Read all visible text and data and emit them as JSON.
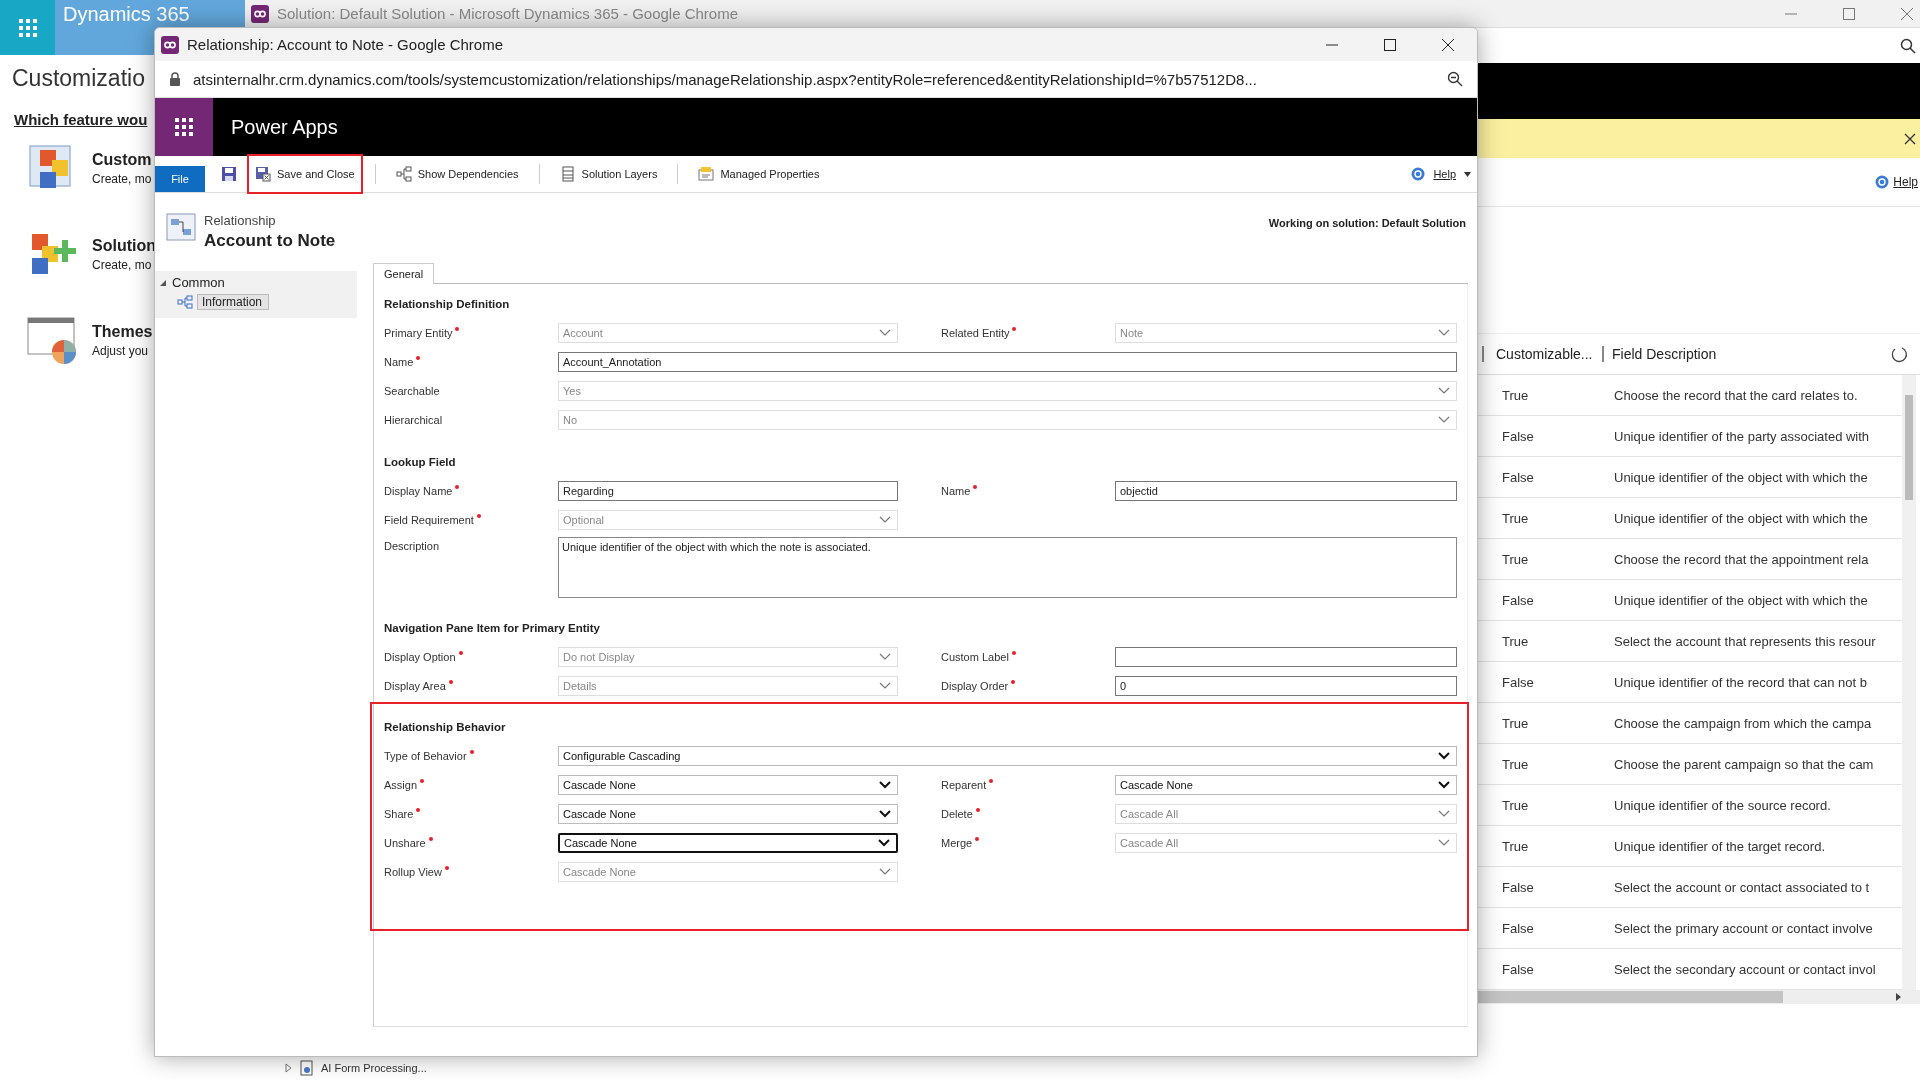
{
  "background": {
    "title": "Solution: Default Solution - Microsoft Dynamics 365 - Google Chrome",
    "app_name": "Dynamics 365",
    "page_title": "Customizatio",
    "question": "Which feature wou",
    "features": [
      {
        "title": "Custom",
        "description": "Create, mo"
      },
      {
        "title": "Solution",
        "description": "Create, mo"
      },
      {
        "title": "Themes",
        "description": "Adjust you"
      }
    ],
    "help": "Help",
    "table": {
      "columns": [
        "Customizable...",
        "Field Description"
      ],
      "rows": [
        {
          "customizable": "True",
          "description": "Choose the record that the card relates to."
        },
        {
          "customizable": "False",
          "description": "Unique identifier of the party associated with"
        },
        {
          "customizable": "False",
          "description": "Unique identifier of the object with which the"
        },
        {
          "customizable": "True",
          "description": "Unique identifier of the object with which the"
        },
        {
          "customizable": "True",
          "description": "Choose the record that the appointment rela"
        },
        {
          "customizable": "False",
          "description": "Unique identifier of the object with which the"
        },
        {
          "customizable": "True",
          "description": "Select the account that represents this resour"
        },
        {
          "customizable": "False",
          "description": "Unique identifier of the record that can not b"
        },
        {
          "customizable": "True",
          "description": "Choose the campaign from which the campa"
        },
        {
          "customizable": "True",
          "description": "Choose the parent campaign so that the cam"
        },
        {
          "customizable": "True",
          "description": "Unique identifier of the source record."
        },
        {
          "customizable": "True",
          "description": "Unique identifier of the target record."
        },
        {
          "customizable": "False",
          "description": "Select the account or contact associated to t"
        },
        {
          "customizable": "False",
          "description": "Select the primary account or contact involve"
        },
        {
          "customizable": "False",
          "description": "Select the secondary account or contact invol"
        }
      ]
    },
    "tree_item": {
      "label": "AI Form Processing...",
      "expanded": false
    }
  },
  "dialog": {
    "title": "Relationship: Account to Note - Google Chrome",
    "url": "atsinternalhr.crm.dynamics.com/tools/systemcustomization/relationships/manageRelationship.aspx?entityRole=referenced&entityRelationshipId=%7b57512D8...",
    "app_name": "Power Apps",
    "toolbar": {
      "file": "File",
      "items": [
        {
          "label": "Save and Close",
          "highlighted": true
        },
        {
          "label": "Show Dependencies",
          "highlighted": false
        },
        {
          "label": "Solution Layers",
          "highlighted": false
        },
        {
          "label": "Managed Properties",
          "highlighted": false
        }
      ],
      "help": "Help"
    },
    "record_type": "Relationship",
    "record_name": "Account to Note",
    "solution_note": "Working on solution: Default Solution",
    "nav": [
      {
        "label": "Common",
        "expanded": true,
        "children": [
          {
            "label": "Information",
            "selected": true
          }
        ]
      }
    ],
    "tabs": [
      {
        "label": "General",
        "selected": true
      }
    ],
    "sections": [
      {
        "title": "Relationship Definition",
        "highlighted": false,
        "rows": [
          [
            {
              "label": "Primary Entity",
              "required": true,
              "kind": "select",
              "value": "Account",
              "disabled": true,
              "focused": false
            },
            {
              "label": "Related Entity",
              "required": true,
              "kind": "select",
              "value": "Note",
              "disabled": true,
              "focused": false
            }
          ],
          [
            {
              "label": "Name",
              "required": true,
              "kind": "text",
              "value": "Account_Annotation",
              "disabled": false,
              "focused": false,
              "wide": true
            }
          ],
          [
            {
              "label": "Searchable",
              "required": false,
              "kind": "select",
              "value": "Yes",
              "disabled": true,
              "focused": false,
              "wide": true
            }
          ],
          [
            {
              "label": "Hierarchical",
              "required": false,
              "kind": "select",
              "value": "No",
              "disabled": true,
              "focused": false,
              "wide": true
            }
          ]
        ]
      },
      {
        "title": "Lookup Field",
        "highlighted": false,
        "rows": [
          [
            {
              "label": "Display Name",
              "required": true,
              "kind": "text",
              "value": "Regarding",
              "disabled": false,
              "focused": false
            },
            {
              "label": "Name",
              "required": true,
              "kind": "text",
              "value": "objectid",
              "disabled": false,
              "focused": false
            }
          ],
          [
            {
              "label": "Field Requirement",
              "required": true,
              "kind": "select",
              "value": "Optional",
              "disabled": true,
              "focused": false
            }
          ],
          [
            {
              "label": "Description",
              "required": false,
              "kind": "textarea",
              "value": "Unique identifier of the object with which the note is associated.",
              "disabled": false,
              "focused": false,
              "wide": true
            }
          ]
        ]
      },
      {
        "title": "Navigation Pane Item for Primary Entity",
        "highlighted": false,
        "rows": [
          [
            {
              "label": "Display Option",
              "required": true,
              "kind": "select",
              "value": "Do not Display",
              "disabled": true,
              "focused": false
            },
            {
              "label": "Custom Label",
              "required": true,
              "kind": "text",
              "disabled": false,
              "focused": false
            }
          ],
          [
            {
              "label": "Display Area",
              "required": true,
              "kind": "select",
              "value": "Details",
              "disabled": true,
              "focused": false
            },
            {
              "label": "Display Order",
              "required": true,
              "kind": "text",
              "value": "0",
              "disabled": false,
              "focused": false
            }
          ]
        ]
      },
      {
        "title": "Relationship Behavior",
        "highlighted": true,
        "rows": [
          [
            {
              "label": "Type of Behavior",
              "required": true,
              "kind": "select",
              "value": "Configurable Cascading",
              "disabled": false,
              "focused": false,
              "wide": true
            }
          ],
          [
            {
              "label": "Assign",
              "required": true,
              "kind": "select",
              "value": "Cascade None",
              "disabled": false,
              "focused": false
            },
            {
              "label": "Reparent",
              "required": true,
              "kind": "select",
              "value": "Cascade None",
              "disabled": false,
              "focused": false
            }
          ],
          [
            {
              "label": "Share",
              "required": true,
              "kind": "select",
              "value": "Cascade None",
              "disabled": false,
              "focused": false
            },
            {
              "label": "Delete",
              "required": true,
              "kind": "select",
              "value": "Cascade All",
              "disabled": true,
              "focused": false
            }
          ],
          [
            {
              "label": "Unshare",
              "required": true,
              "kind": "select",
              "value": "Cascade None",
              "disabled": false,
              "focused": true
            },
            {
              "label": "Merge",
              "required": true,
              "kind": "select",
              "value": "Cascade All",
              "disabled": true,
              "focused": false
            }
          ],
          [
            {
              "label": "Rollup View",
              "required": true,
              "kind": "select",
              "value": "Cascade None",
              "disabled": true,
              "focused": false
            }
          ]
        ]
      }
    ]
  }
}
